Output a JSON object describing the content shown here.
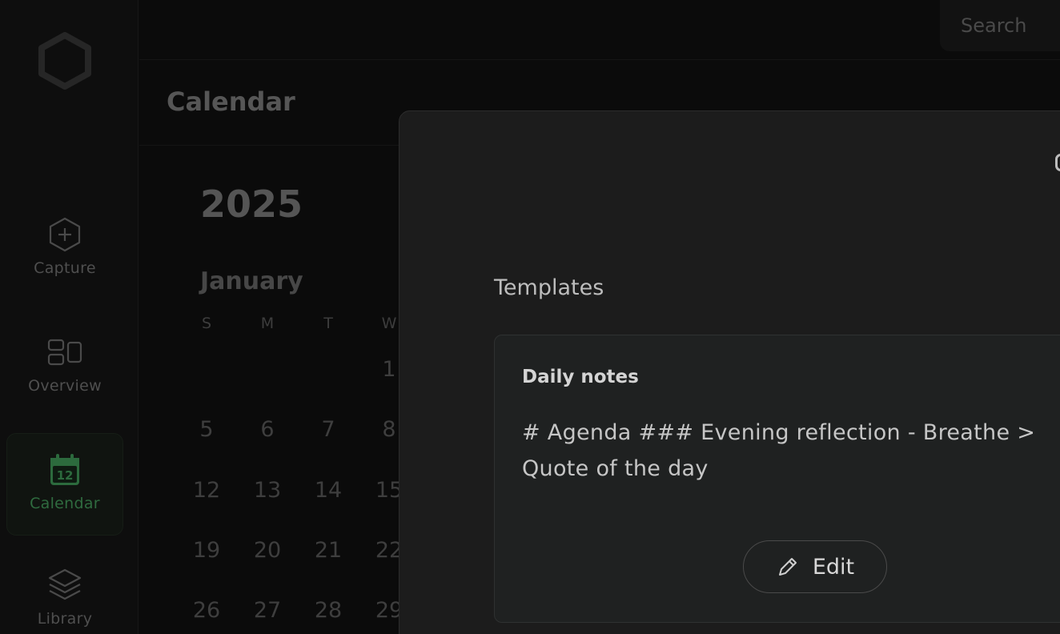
{
  "sidebar": {
    "items": [
      {
        "label": "Capture",
        "icon": "plus-hexagon-icon"
      },
      {
        "label": "Overview",
        "icon": "grid-layout-icon"
      },
      {
        "label": "Calendar",
        "icon": "calendar-icon",
        "icon_text": "12",
        "active": true
      },
      {
        "label": "Library",
        "icon": "layers-icon"
      }
    ]
  },
  "header": {
    "search_label": "Search"
  },
  "page": {
    "title": "Calendar"
  },
  "calendar": {
    "year": "2025",
    "month": "January",
    "weekdays": [
      "S",
      "M",
      "T",
      "W"
    ],
    "weeks": [
      [
        "",
        "",
        "",
        "1"
      ],
      [
        "5",
        "6",
        "7",
        "8"
      ],
      [
        "12",
        "13",
        "14",
        "15"
      ],
      [
        "19",
        "20",
        "21",
        "22"
      ],
      [
        "26",
        "27",
        "28",
        "29"
      ]
    ]
  },
  "modal": {
    "section_title": "Templates",
    "template": {
      "title": "Daily notes",
      "body": "# Agenda ### Evening reflection - Breathe > Quote of the day",
      "edit_label": "Edit"
    }
  },
  "colors": {
    "accent": "#2f6b3f",
    "background": "#0b0b0b",
    "modal": "#1c1c1c"
  }
}
